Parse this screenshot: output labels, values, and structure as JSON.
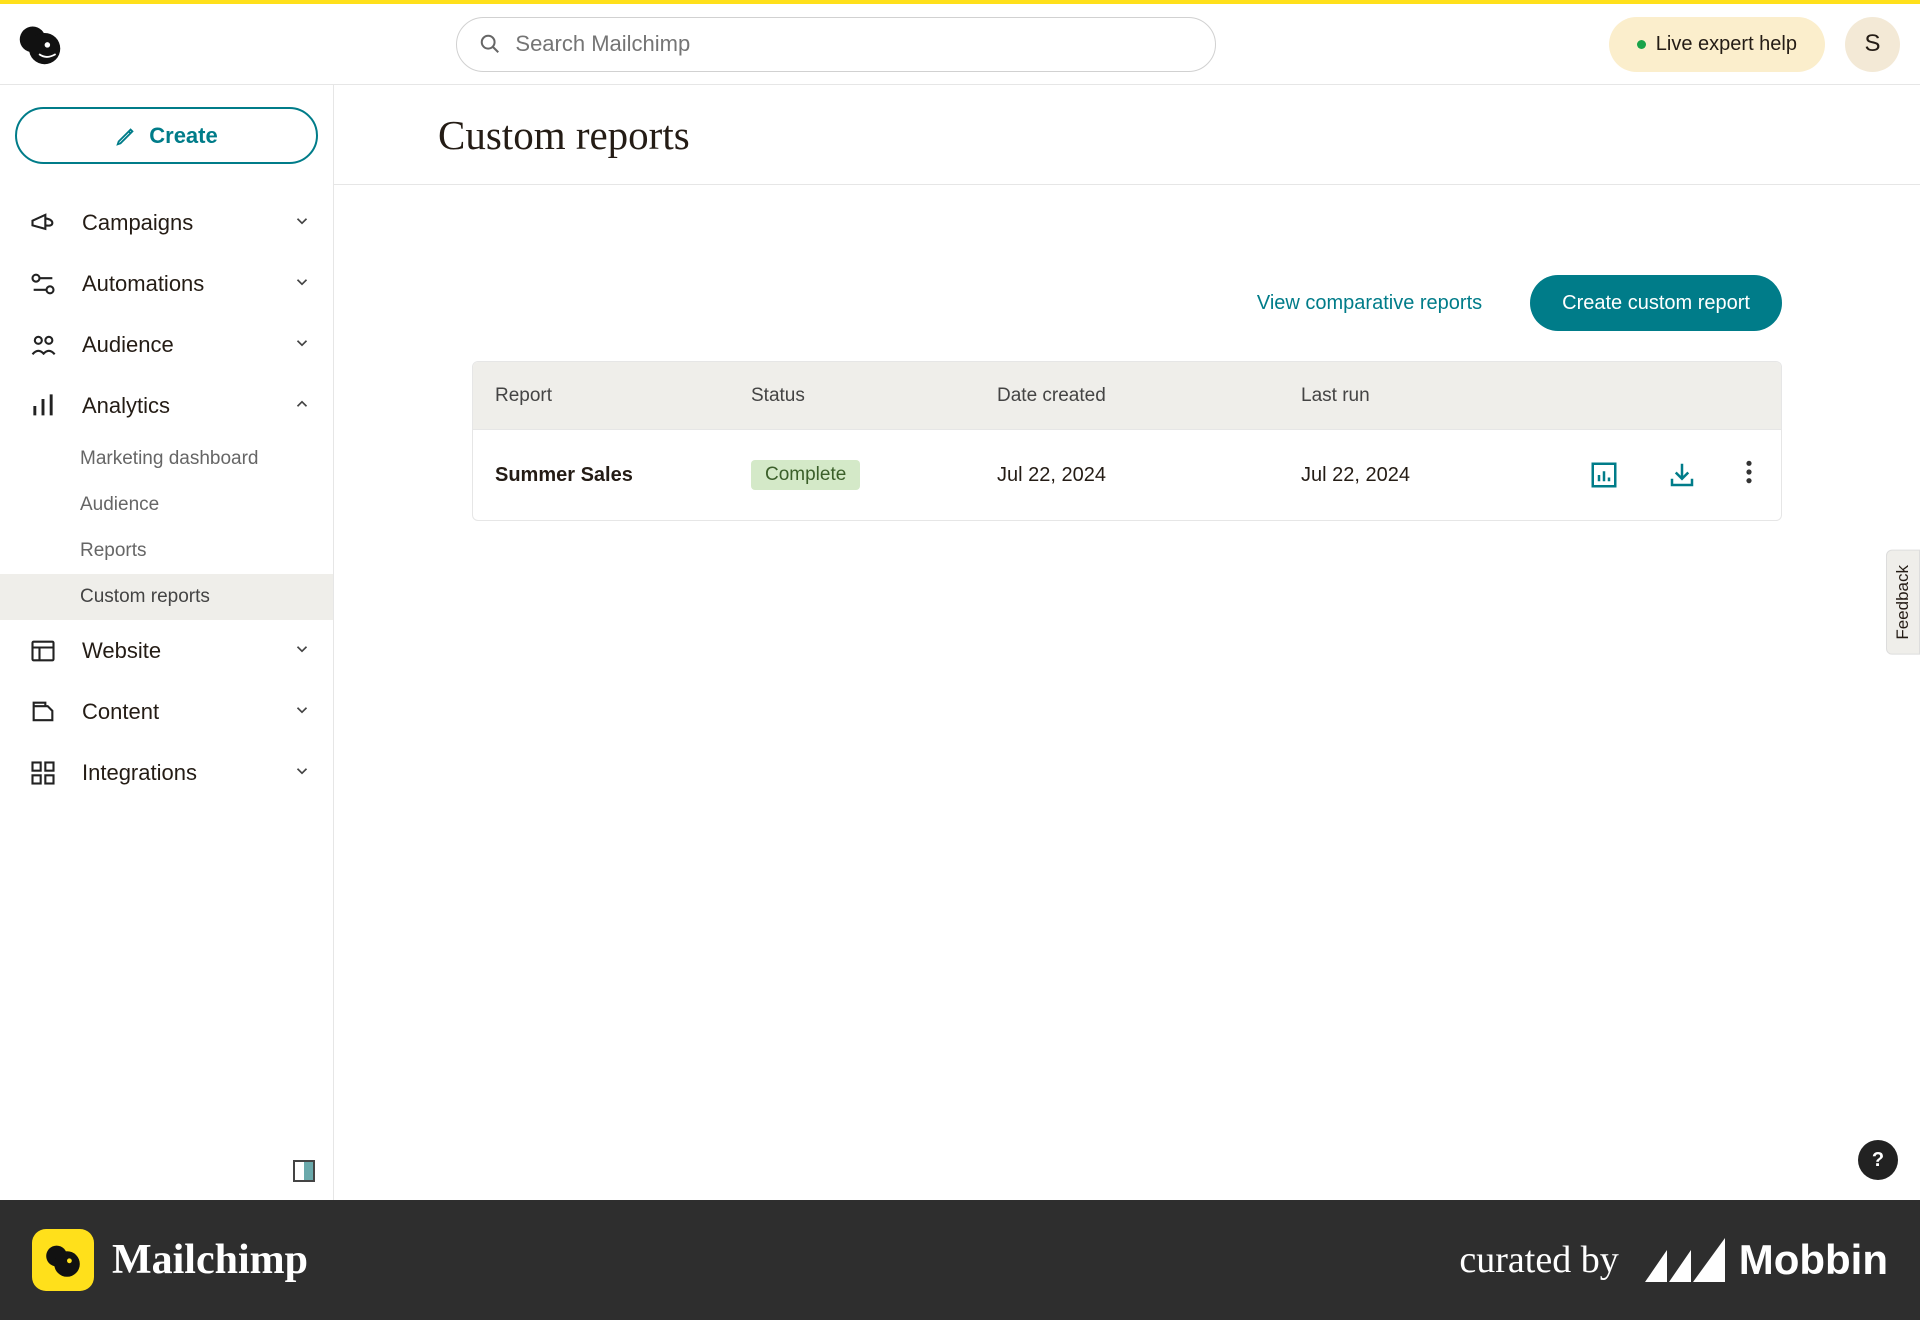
{
  "header": {
    "search_placeholder": "Search Mailchimp",
    "live_help": "Live expert help",
    "avatar_initial": "S"
  },
  "sidebar": {
    "create_label": "Create",
    "items": [
      {
        "label": "Campaigns"
      },
      {
        "label": "Automations"
      },
      {
        "label": "Audience"
      },
      {
        "label": "Analytics"
      },
      {
        "label": "Website"
      },
      {
        "label": "Content"
      },
      {
        "label": "Integrations"
      }
    ],
    "analytics_sub": [
      {
        "label": "Marketing dashboard"
      },
      {
        "label": "Audience"
      },
      {
        "label": "Reports"
      },
      {
        "label": "Custom reports"
      }
    ]
  },
  "main": {
    "title": "Custom reports",
    "view_comparative": "View comparative reports",
    "create_report": "Create custom report",
    "columns": {
      "report": "Report",
      "status": "Status",
      "created": "Date created",
      "lastrun": "Last run"
    },
    "rows": [
      {
        "name": "Summer Sales",
        "status": "Complete",
        "created": "Jul 22, 2024",
        "lastrun": "Jul 22, 2024"
      }
    ],
    "feedback": "Feedback"
  },
  "footer": {
    "brand": "Mailchimp",
    "curated": "curated by",
    "mobbin": "Mobbin"
  }
}
